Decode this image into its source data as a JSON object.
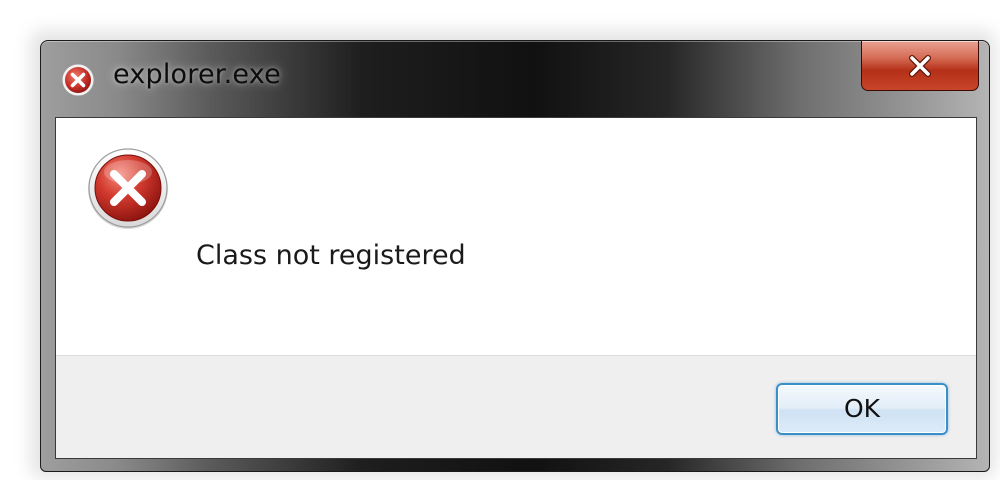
{
  "window": {
    "title": "explorer.exe"
  },
  "title_icon": "error-icon",
  "close_button": {
    "icon": "close-icon"
  },
  "dialog": {
    "icon": "error-icon",
    "message": "Class not registered"
  },
  "buttons": {
    "ok_label": "OK"
  },
  "colors": {
    "error_red": "#c8322a",
    "close_button_red": "#c8452a",
    "ok_button_border": "#3b8fc9",
    "footer_background": "#efefef"
  }
}
